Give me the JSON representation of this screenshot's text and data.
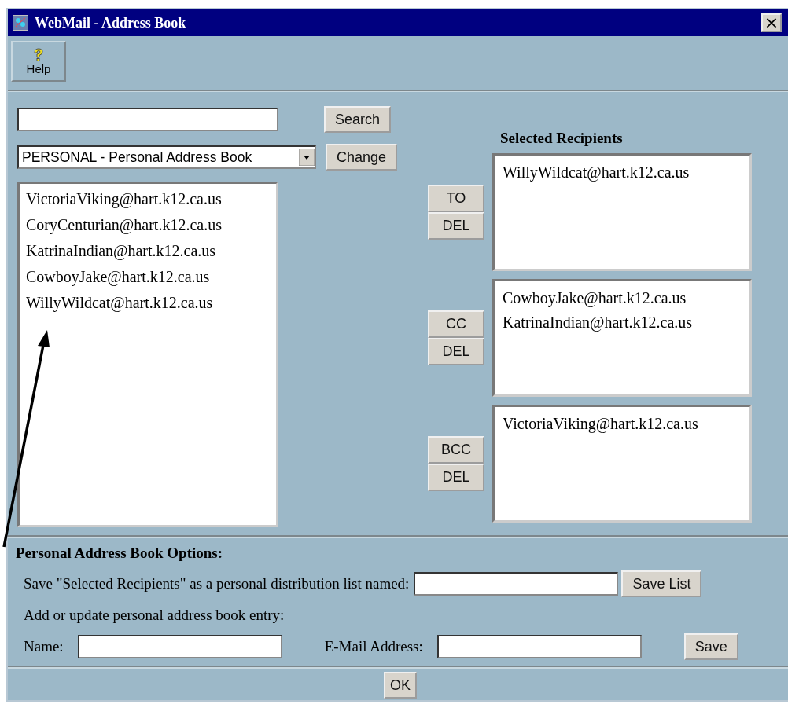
{
  "window": {
    "title": "WebMail - Address Book",
    "close": "×"
  },
  "toolbar": {
    "buttons": [
      {
        "label": "Help"
      }
    ]
  },
  "search": {
    "button": "Search"
  },
  "book": {
    "value": "PERSONAL - Personal Address Book",
    "button": "Change"
  },
  "address_list": [
    "VictoriaViking@hart.k12.ca.us",
    "CoryCenturian@hart.k12.ca.us",
    "KatrinaIndian@hart.k12.ca.us",
    "CowboyJake@hart.k12.ca.us",
    "WillyWildcat@hart.k12.ca.us"
  ],
  "recipients": {
    "title": "Selected Recipients",
    "groups": [
      {
        "add_button": "TO",
        "delete_button": "DEL",
        "entries": [
          "WillyWildcat@hart.k12.ca.us"
        ]
      },
      {
        "add_button": "CC",
        "delete_button": "DEL",
        "entries": [
          "CowboyJake@hart.k12.ca.us",
          "KatrinaIndian@hart.k12.ca.us"
        ]
      },
      {
        "add_button": "BCC",
        "delete_button": "DEL",
        "entries": [
          "VictoriaViking@hart.k12.ca.us"
        ]
      }
    ]
  },
  "options": {
    "title": "Personal Address Book Options:",
    "save_list_label": "Save \"Selected Recipients\" as a personal distribution list named:",
    "save_list_button": "Save List",
    "entry_label": "Add or update personal address book entry:",
    "name_label": "Name:",
    "email_label": "E-Mail Address:",
    "save_button": "Save"
  },
  "ok_button": "OK"
}
